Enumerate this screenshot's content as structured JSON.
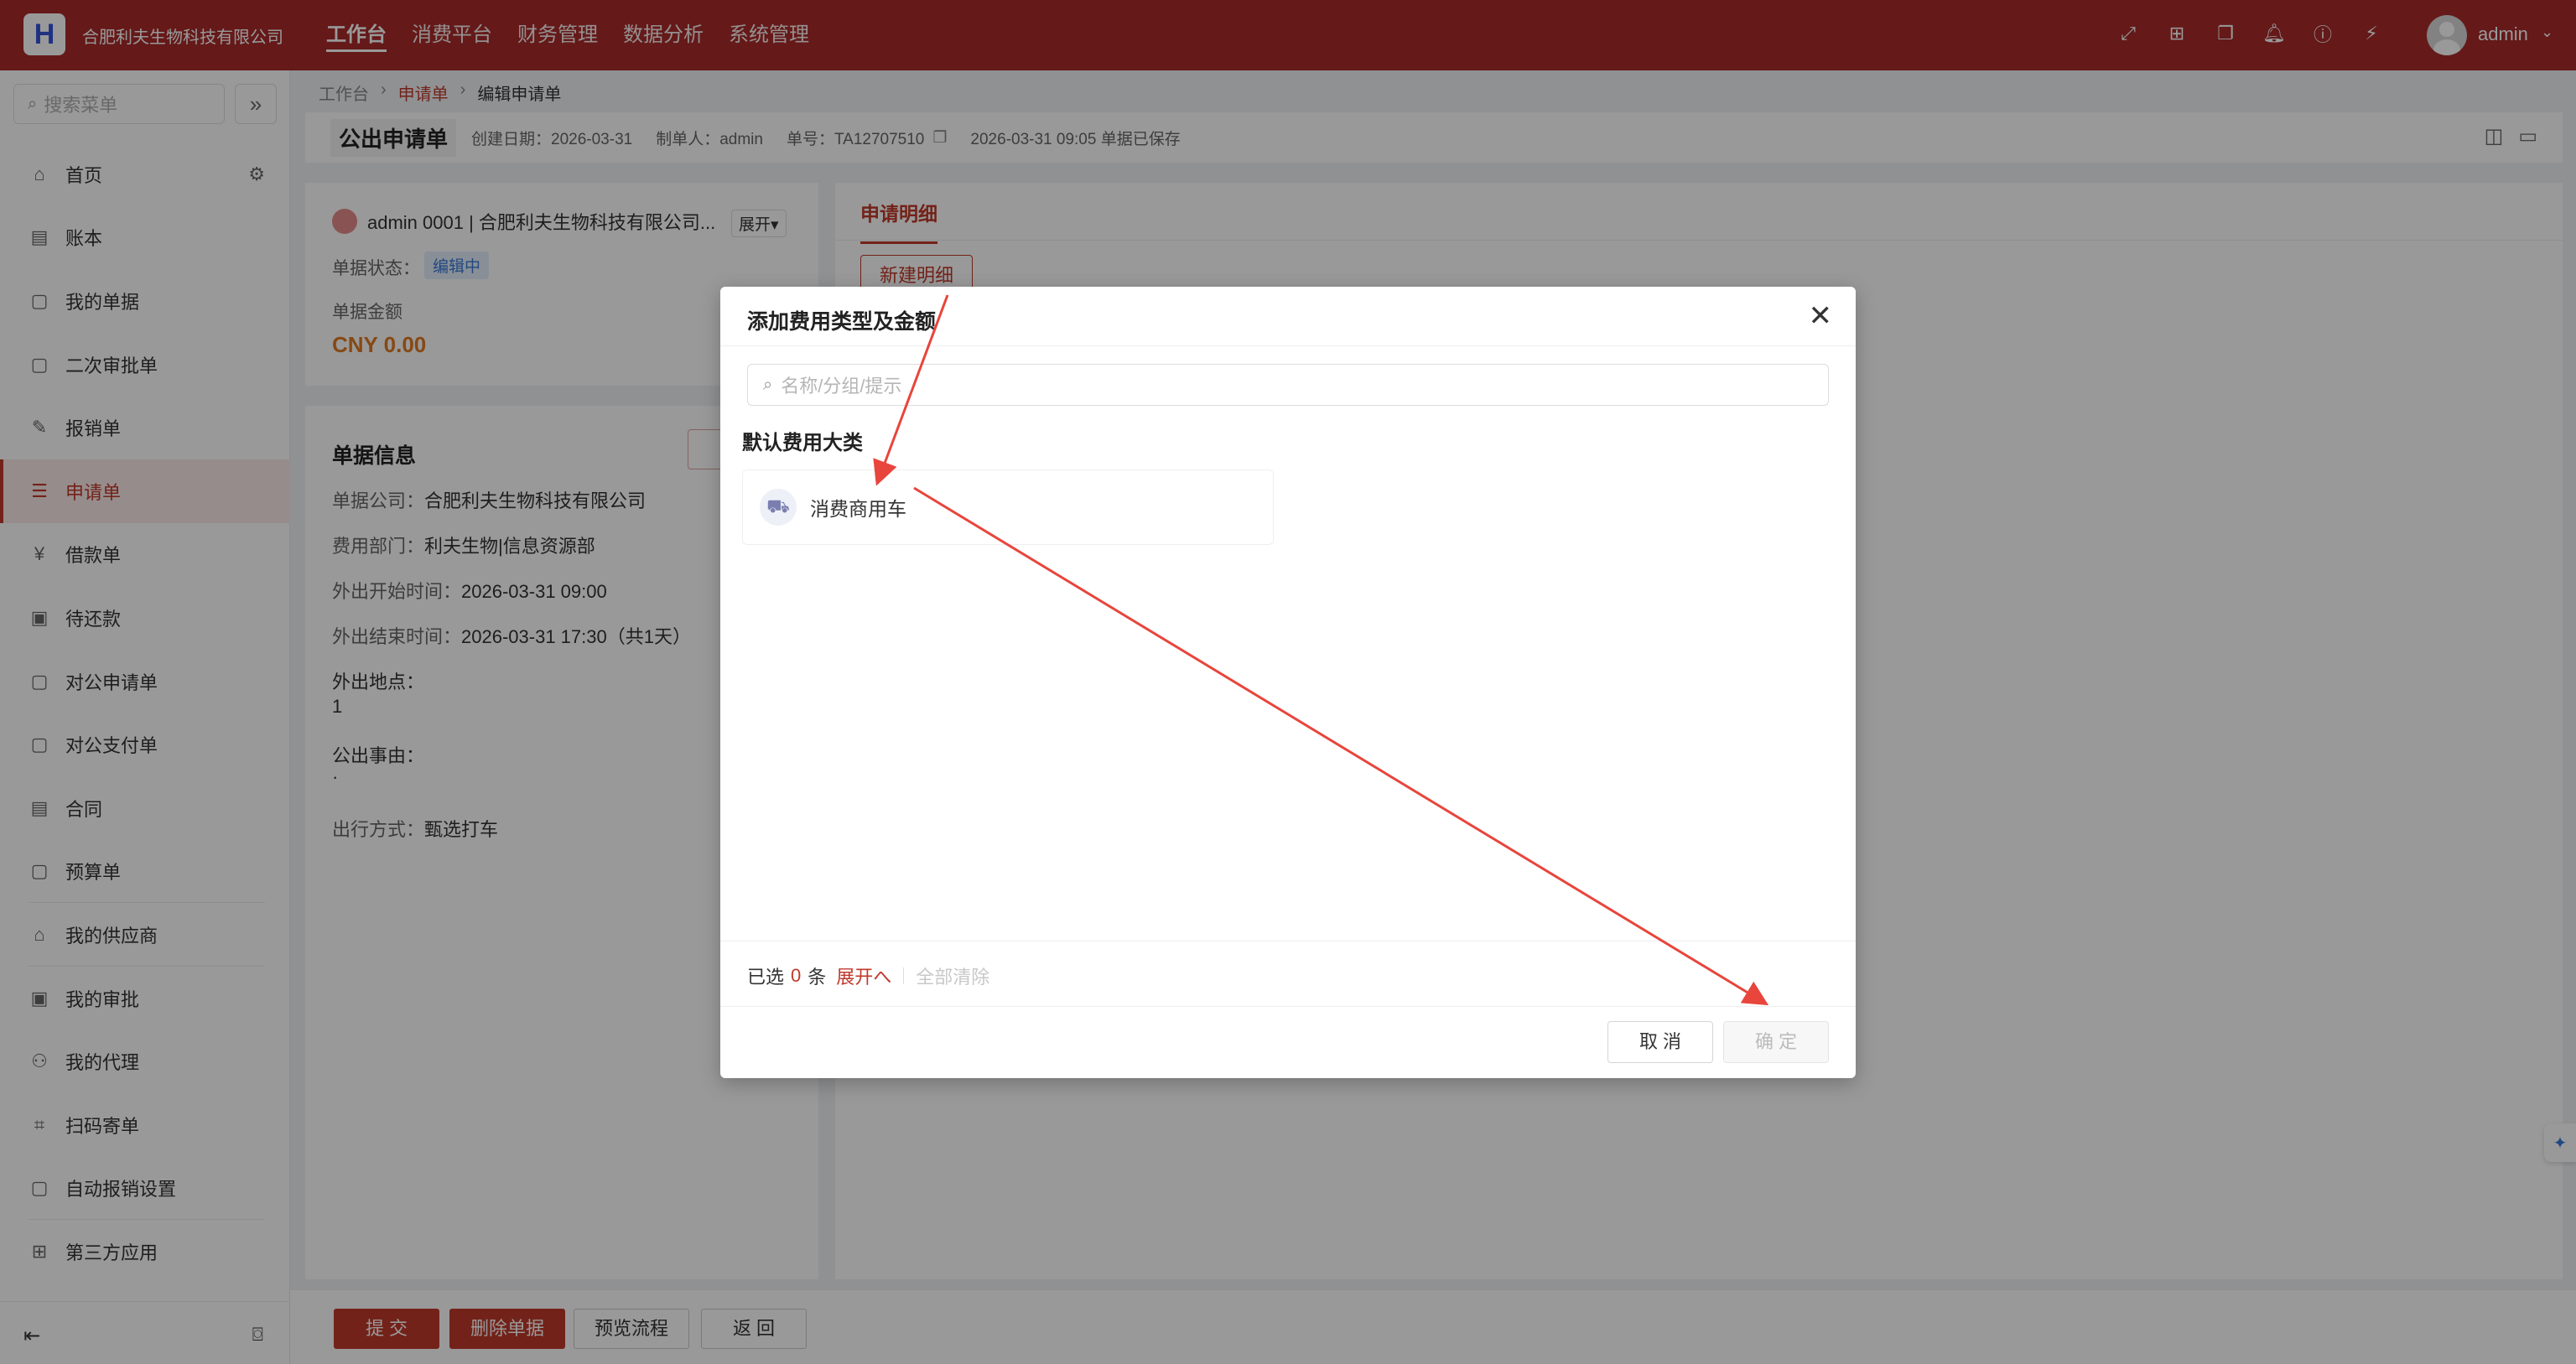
{
  "topbar": {
    "logo": "H",
    "company": "合肥利夫生物科技有限公司",
    "nav": [
      "工作台",
      "消费平台",
      "财务管理",
      "数据分析",
      "系统管理"
    ],
    "user": "admin",
    "icons": [
      "fullscreen-icon",
      "apps-icon",
      "windows-icon",
      "bell-icon",
      "help-icon",
      "plugin-icon"
    ]
  },
  "sidebar": {
    "search_placeholder": "搜索菜单",
    "items": [
      {
        "label": "首页",
        "icon": "home-icon"
      },
      {
        "label": "账本",
        "icon": "book-icon"
      },
      {
        "label": "我的单据",
        "icon": "doc-icon"
      },
      {
        "label": "二次审批单",
        "icon": "doc-check-icon"
      },
      {
        "label": "报销单",
        "icon": "doc-edit-icon"
      },
      {
        "label": "申请单",
        "icon": "doc-list-icon"
      },
      {
        "label": "借款单",
        "icon": "yen-icon"
      },
      {
        "label": "待还款",
        "icon": "repay-icon"
      },
      {
        "label": "对公申请单",
        "icon": "doc-search-icon"
      },
      {
        "label": "对公支付单",
        "icon": "doc-pay-icon"
      },
      {
        "label": "合同",
        "icon": "contract-icon"
      },
      {
        "label": "预算单",
        "icon": "budget-icon"
      },
      {
        "label": "我的供应商",
        "icon": "store-icon"
      },
      {
        "label": "我的审批",
        "icon": "approval-icon"
      },
      {
        "label": "我的代理",
        "icon": "agent-icon"
      },
      {
        "label": "扫码寄单",
        "icon": "scan-icon"
      },
      {
        "label": "自动报销设置",
        "icon": "auto-icon"
      },
      {
        "label": "第三方应用",
        "icon": "grid-icon"
      }
    ],
    "active": "申请单"
  },
  "breadcrumb": [
    "工作台",
    "申请单",
    "编辑申请单"
  ],
  "header": {
    "title": "公出申请单",
    "created": "创建日期：2026-03-31",
    "maker": "制单人：admin",
    "number": "单号：TA12707510",
    "saved": "2026-03-31 09:05 单据已保存"
  },
  "summary": {
    "user": "admin 0001 | 合肥利夫生物科技有限公司...",
    "expand": "展开▾",
    "status_label": "单据状态：",
    "status": "编辑中",
    "amount_label": "单据金额",
    "amount": "CNY 0.00"
  },
  "info": {
    "title": "单据信息",
    "company_k": "单据公司：",
    "company_v": "合肥利夫生物科技有限公司",
    "dept_k": "费用部门：",
    "dept_v": "利夫生物|信息资源部",
    "start_k": "外出开始时间：",
    "start_v": "2026-03-31 09:00",
    "end_k": "外出结束时间：",
    "end_v": "2026-03-31 17:30（共1天）",
    "place_k": "外出地点：",
    "place_v": "1",
    "reason_k": "公出事由：",
    "reason_v": "·",
    "travel_k": "出行方式：",
    "travel_v": "甄选打车"
  },
  "detail": {
    "tab": "申请明细",
    "new_button": "新建明细"
  },
  "bottom": {
    "submit": "提 交",
    "delete": "删除单据",
    "preview": "预览流程",
    "back": "返 回"
  },
  "modal": {
    "title": "添加费用类型及金额",
    "search_placeholder": "名称/分组/提示",
    "section": "默认费用大类",
    "item": "消费商用车",
    "selected_prefix": "已选",
    "selected_count": "0",
    "selected_suffix": "条",
    "expand": "展开へ",
    "clear": "全部清除",
    "cancel": "取 消",
    "ok": "确 定"
  },
  "colors": {
    "brand": "#a82b2a",
    "accent": "#c0392b",
    "amount": "#e07a22",
    "status": "#3a78d6"
  }
}
